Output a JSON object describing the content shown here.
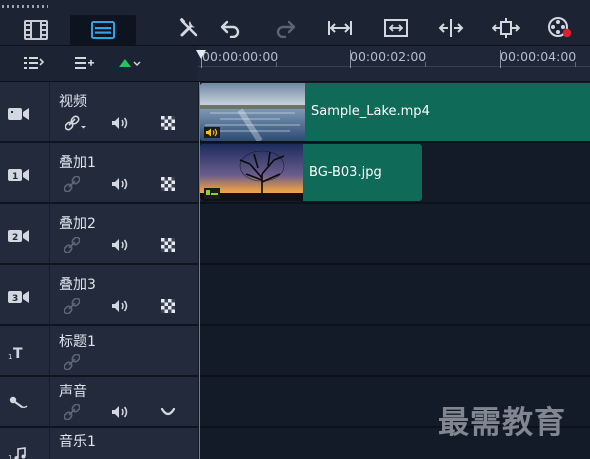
{
  "toolbar": {
    "storyboard_view_icon": "film-strip-icon",
    "timeline_view_icon": "timeline-view-icon",
    "tools_icon": "tools-icon",
    "undo_icon": "undo-icon",
    "redo_icon": "redo-icon",
    "fit_icon": "fit-to-window-icon",
    "resize_icon": "project-aspect-icon",
    "split_icon": "split-icon",
    "trim_icon": "smart-trim-icon",
    "record_icon": "record-capture-icon"
  },
  "subbar": {
    "track_manager_icon": "track-manager-icon",
    "add_remove_chapter_icon": "chapter-points-icon",
    "marker_icon": "marker-dropdown-icon"
  },
  "ruler": {
    "labels": [
      "00:00:00:00",
      "00:00:02:00",
      "00:00:04:00"
    ]
  },
  "tracks": [
    {
      "name": "视频",
      "type_icon": "video-track-icon",
      "link_icon": "link-dropdown-icon",
      "audio_icon": "speaker-icon",
      "mask_icon": "checker-icon"
    },
    {
      "name": "叠加1",
      "type_icon": "overlay-track-1-icon",
      "link_icon": "link-icon",
      "audio_icon": "speaker-icon",
      "mask_icon": "checker-icon"
    },
    {
      "name": "叠加2",
      "type_icon": "overlay-track-2-icon",
      "link_icon": "link-icon",
      "audio_icon": "speaker-icon",
      "mask_icon": "checker-icon"
    },
    {
      "name": "叠加3",
      "type_icon": "overlay-track-3-icon",
      "link_icon": "link-icon",
      "audio_icon": "speaker-icon",
      "mask_icon": "checker-icon"
    },
    {
      "name": "标题1",
      "type_icon": "title-track-icon",
      "link_icon": "link-icon"
    },
    {
      "name": "声音",
      "type_icon": "voice-track-icon",
      "link_icon": "link-icon",
      "audio_icon": "speaker-icon",
      "duck_icon": "ducking-icon"
    },
    {
      "name": "音乐1",
      "type_icon": "music-track-icon",
      "link_icon": "link-icon",
      "audio_icon": "speaker-icon",
      "duck_icon": "ducking-icon"
    }
  ],
  "clips": {
    "video": {
      "name": "Sample_Lake.mp4",
      "color": "#0f6b58"
    },
    "overlay": {
      "name": "BG-B03.jpg",
      "color": "#0f6b58"
    }
  },
  "watermark": "最需教育",
  "colors": {
    "clip": "#0f6b58",
    "accent_blue": "#2aa6e8",
    "accent_green": "#22c55e",
    "record_red": "#e11d2e"
  }
}
